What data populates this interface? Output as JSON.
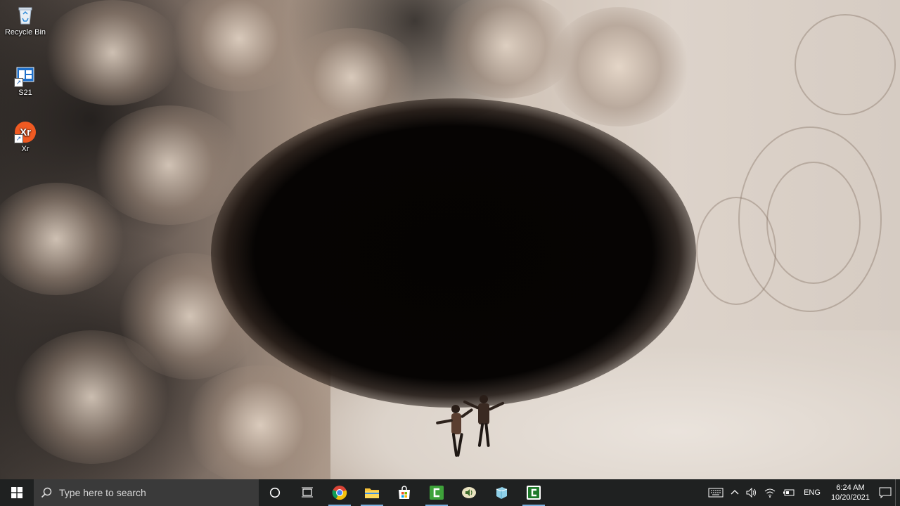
{
  "desktop": {
    "icons": [
      {
        "label": "Recycle Bin",
        "icon": "recycle-bin-icon"
      },
      {
        "label": "S21",
        "icon": "app-window-icon"
      },
      {
        "label": "Xr",
        "icon": "xr-app-icon"
      }
    ]
  },
  "taskbar": {
    "start_icon": "windows-logo-icon",
    "search_placeholder": "Type here to search",
    "apps": [
      {
        "name": "cortana-button",
        "icon": "circle-icon"
      },
      {
        "name": "task-view-button",
        "icon": "task-view-icon"
      },
      {
        "name": "chrome",
        "icon": "chrome-icon",
        "active": true
      },
      {
        "name": "file-explorer",
        "icon": "folder-icon",
        "active": true
      },
      {
        "name": "microsoft-store",
        "icon": "store-icon"
      },
      {
        "name": "camtasia",
        "icon": "camtasia-icon",
        "active": true
      },
      {
        "name": "audio-app",
        "icon": "speaker-app-icon"
      },
      {
        "name": "cube-app",
        "icon": "cube-icon"
      },
      {
        "name": "camtasia-recorder",
        "icon": "camtasia-recorder-icon",
        "active": true
      }
    ],
    "tray": {
      "language": "ENG",
      "time": "6:24 AM",
      "date": "10/20/2021"
    },
    "accent_color": "#7db2e0"
  }
}
